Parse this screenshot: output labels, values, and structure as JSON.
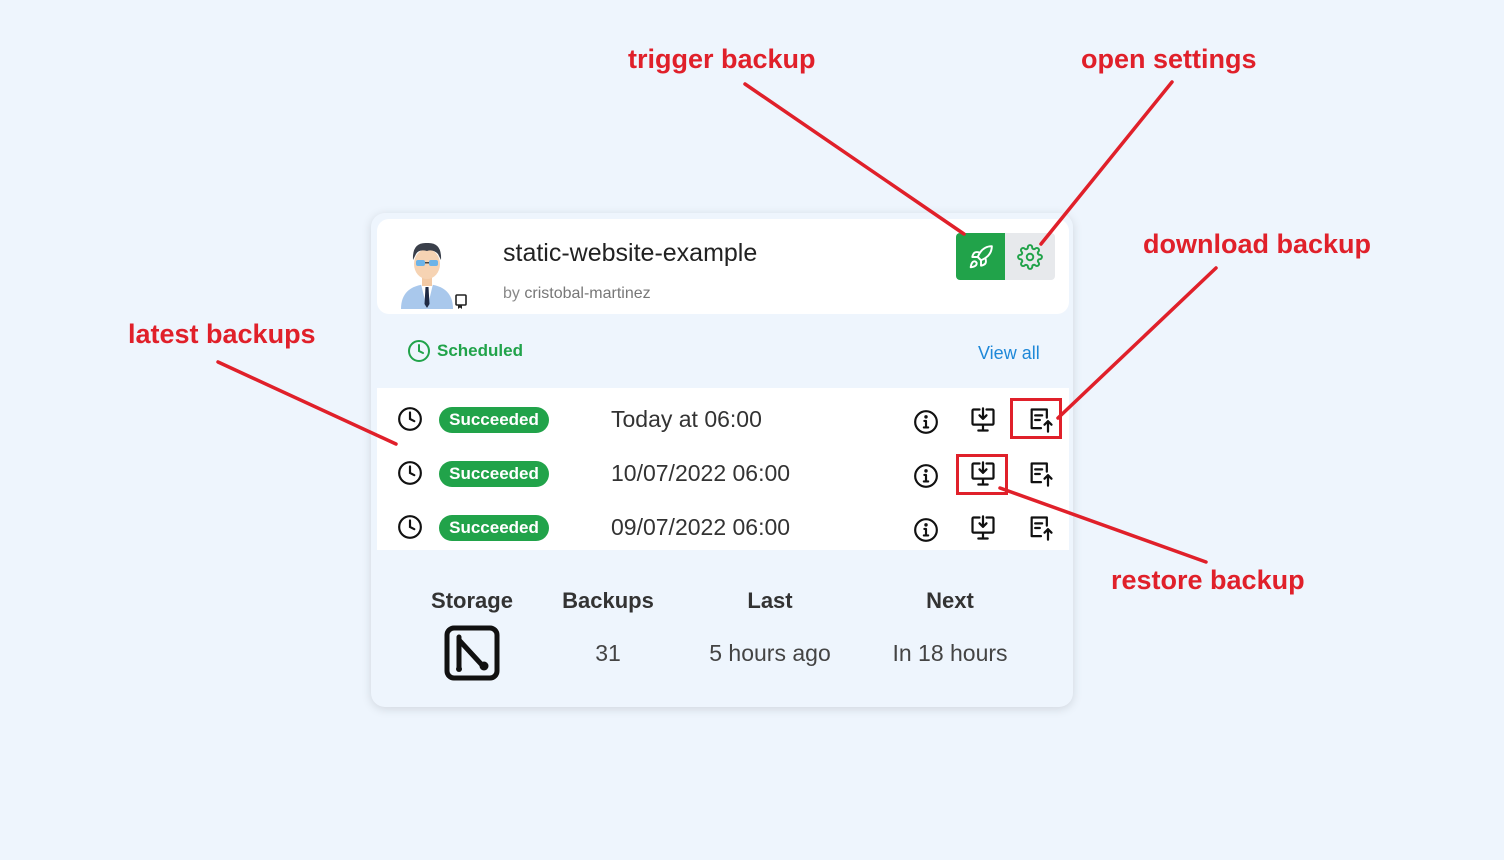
{
  "card": {
    "title": "static-website-example",
    "by_prefix": "by",
    "author": "cristobal-martinez",
    "schedule_label": "Scheduled",
    "view_all": "View all"
  },
  "backups": [
    {
      "status": "Succeeded",
      "date": "Today at 06:00"
    },
    {
      "status": "Succeeded",
      "date": "10/07/2022 06:00"
    },
    {
      "status": "Succeeded",
      "date": "09/07/2022 06:00"
    }
  ],
  "stats": {
    "storage_label": "Storage",
    "backups_label": "Backups",
    "backups_value": "31",
    "last_label": "Last",
    "last_value": "5 hours ago",
    "next_label": "Next",
    "next_value": "In 18 hours"
  },
  "annotations": {
    "trigger": "trigger backup",
    "settings": "open settings",
    "download": "download backup",
    "latest": "latest backups",
    "restore": "restore backup"
  },
  "colors": {
    "success": "#21a34a",
    "annotation": "#e0202a",
    "link": "#1e88d8",
    "background": "#eef5fd"
  },
  "icons": [
    "user-avatar-icon",
    "repo-icon",
    "rocket-icon",
    "gear-icon",
    "clock-icon",
    "info-icon",
    "restore-icon",
    "download-icon",
    "storage-provider-icon"
  ]
}
